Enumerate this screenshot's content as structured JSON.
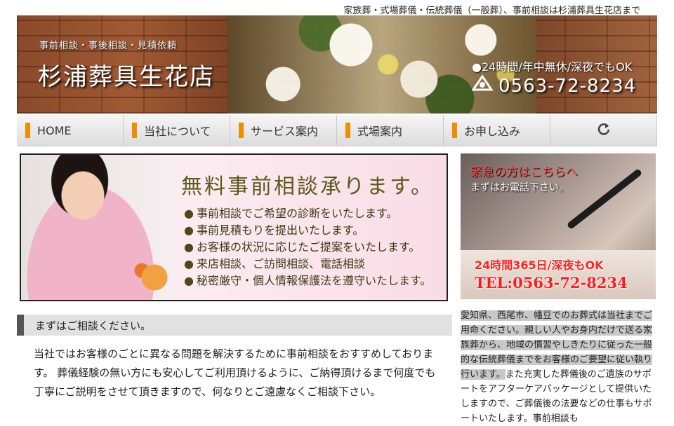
{
  "header": {
    "tagline": "家族葬・式場葬儀・伝統葬儀（一般葬）、事前相談は杉浦葬具生花店まで"
  },
  "banner": {
    "subtitle": "事前相談・事後相談・見積依頼",
    "title": "杉浦葬具生花店",
    "hours": "●24時間/年中無休/深夜でもOK",
    "phone": "0563-72-8234"
  },
  "nav": {
    "items": [
      {
        "label": "HOME"
      },
      {
        "label": "当社について"
      },
      {
        "label": "サービス案内"
      },
      {
        "label": "式場案内"
      },
      {
        "label": "お申し込み"
      }
    ]
  },
  "promo": {
    "title": "無料事前相談承ります。",
    "items": [
      "事前相談でご希望の診断をいたします。",
      "事前見積もりを提出いたします。",
      "お客様の状況に応じたご提案をいたします。",
      "来店相談、ご訪問相談、電話相談",
      "秘密厳守・個人情報保護法を遵守いたします。"
    ]
  },
  "side_banner": {
    "line1": "緊急の方はこちらへ",
    "line2": "まずはお電話下さい。",
    "line3": "24時間365日/深夜もOK",
    "line4": "TEL:0563-72-8234"
  },
  "main": {
    "heading": "まずはご相談ください。",
    "body": "当社ではお客様のごとに異なる問題を解決するために事前相談をおすすめしております。 葬儀経験の無い方にも安心してご利用頂けるように、ご納得頂けるまで何度でも丁寧にご説明をさせて頂きますので、何なりとご遠慮なくご相談下さい。"
  },
  "sidebar": {
    "text_highlight": "愛知県、西尾市、幡豆でのお葬式は当社までご用命ください。親しい人やお身内だけで送る家族葬から、地域の慣習やしきたりに従った一般的な伝統葬儀までをお客様のご要望に従い執り行います。",
    "text_rest": "また充実した葬儀後のご遺族のサポートをアフターケアパッケージとして提供いたしますので、ご葬儀後の法要などの仕事もサポートいたします。事前相談も"
  },
  "icons": {
    "phone": "phone-icon",
    "reload": "reload-icon"
  },
  "colors": {
    "nav_accent": "#f08c00",
    "emergency_red": "#ff1a1a",
    "promo_text": "#5b5a1a"
  }
}
